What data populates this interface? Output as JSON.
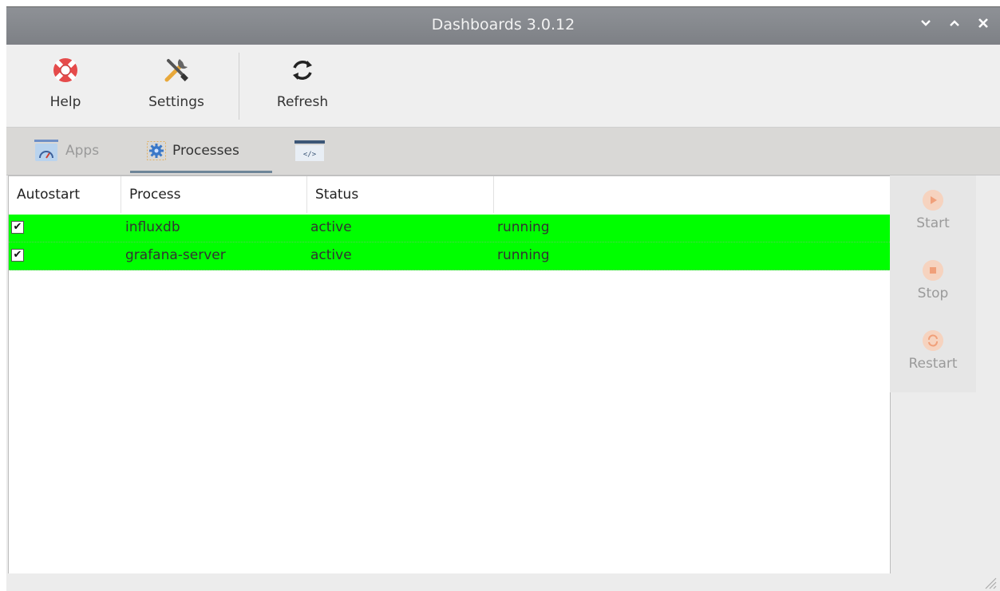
{
  "window": {
    "title": "Dashboards 3.0.12"
  },
  "title_controls": [
    "v",
    "^",
    "x"
  ],
  "toolbar": {
    "help_label": "Help",
    "settings_label": "Settings",
    "refresh_label": "Refresh",
    "icons": {
      "help": "lifebuoy-icon",
      "settings": "tools-icon",
      "refresh": "refresh-icon"
    }
  },
  "tabs": [
    {
      "label": "Apps",
      "icon": "gauge-icon",
      "active": false
    },
    {
      "label": "Processes",
      "icon": "gear-icon",
      "active": true
    },
    {
      "label": "",
      "icon": "code-icon",
      "active": false
    }
  ],
  "table": {
    "columns": [
      "Autostart",
      "Process",
      "Status",
      ""
    ],
    "rows": [
      {
        "autostart": true,
        "process": "influxdb",
        "status": "active",
        "state": "running"
      },
      {
        "autostart": true,
        "process": "grafana-server",
        "status": "active",
        "state": "running"
      }
    ],
    "row_color": "#00ff00"
  },
  "actions": {
    "start_label": "Start",
    "stop_label": "Stop",
    "restart_label": "Restart"
  },
  "colors": {
    "titlebar": "#888b90",
    "active_row": "#00ff00",
    "action_disabled": "#f6d3bf"
  }
}
